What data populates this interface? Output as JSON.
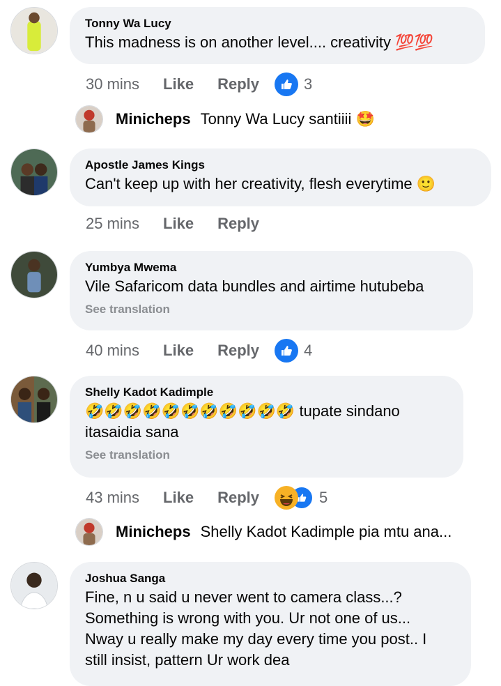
{
  "comments": [
    {
      "name": "Tonny Wa Lucy",
      "text": "This madness is on another level.... creativity 💯💯",
      "time": "30 mins",
      "like": "Like",
      "reply": "Reply",
      "reaction_count": "3",
      "reactions": [
        "like-icon"
      ]
    },
    {
      "name": "Apostle James Kings",
      "text": "Can't keep up with her creativity, flesh  everytime 🙂",
      "time": "25 mins",
      "like": "Like",
      "reply": "Reply"
    },
    {
      "name": "Yumbya Mwema",
      "text": "Vile Safaricom data bundles and airtime hutubeba",
      "see_translation": "See translation",
      "time": "40 mins",
      "like": "Like",
      "reply": "Reply",
      "reaction_count": "4",
      "reactions": [
        "like-icon"
      ]
    },
    {
      "name": "Shelly Kadot Kadimple",
      "text_emojis": "🤣🤣🤣🤣🤣🤣🤣🤣🤣🤣🤣",
      "text_line1": "tupate sindano",
      "text_line2": "itasaidia sana",
      "see_translation": "See translation",
      "time": "43 mins",
      "like": "Like",
      "reply": "Reply",
      "reaction_count": "5",
      "reactions": [
        "haha-icon",
        "like-icon"
      ]
    },
    {
      "name": "Joshua Sanga",
      "lines": [
        "Fine, n u said u never went to camera class...?",
        "Something is wrong with you. Ur not one of us...",
        "Nway u really make my day every time you post.. I",
        "still insist, pattern Ur work dea"
      ]
    }
  ],
  "replies": [
    {
      "name": "Minicheps",
      "text": "Tonny Wa Lucy santiiii 🤩"
    },
    {
      "name": "Minicheps",
      "text": "Shelly Kadot Kadimple pia mtu ana..."
    }
  ]
}
